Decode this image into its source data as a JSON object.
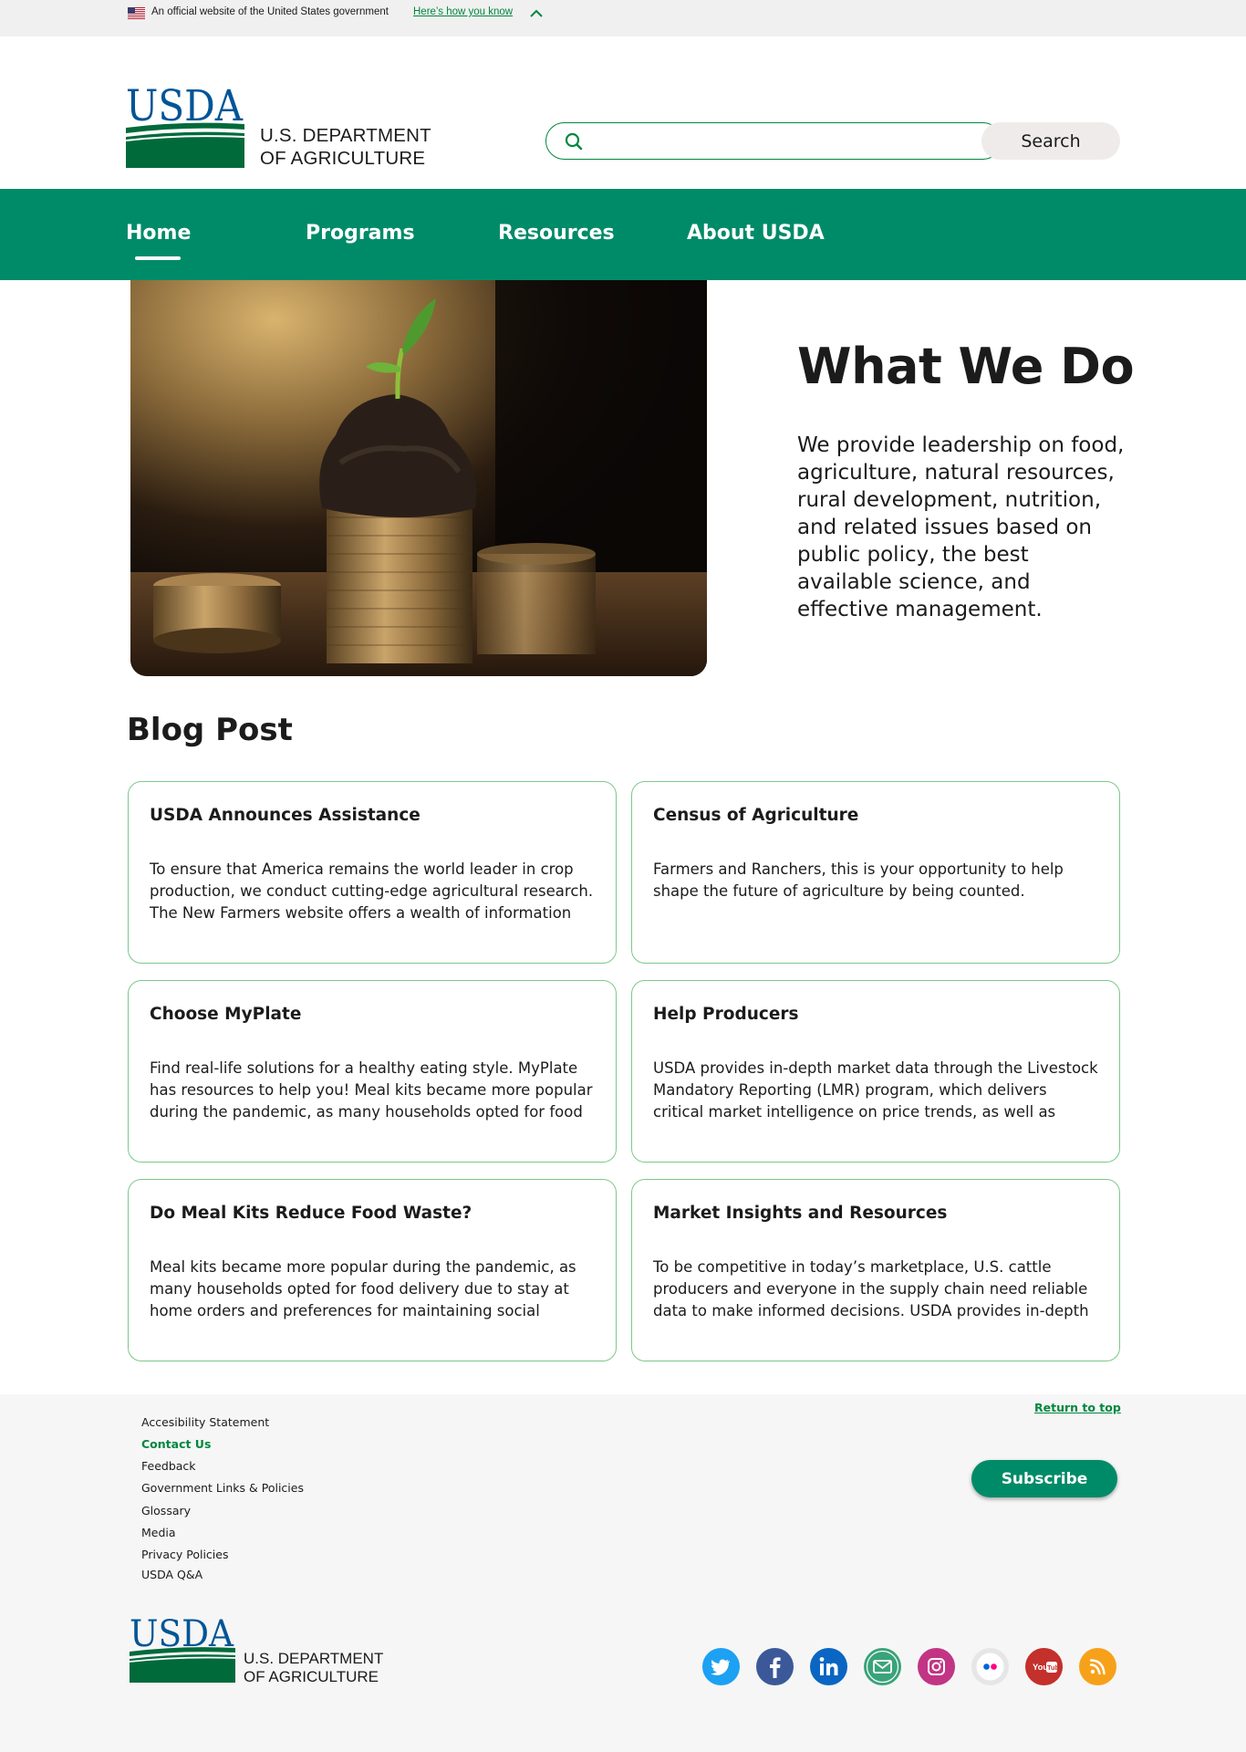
{
  "gov_banner": {
    "text": "An official website of the United States government",
    "link": "Here’s how you know"
  },
  "header": {
    "logo_text": "USDA",
    "agency_line1": "U.S. DEPARTMENT",
    "agency_line2": "OF AGRICULTURE",
    "search_placeholder": "",
    "search_button": "Search"
  },
  "nav": {
    "items": [
      {
        "label": "Home",
        "active": true
      },
      {
        "label": "Programs"
      },
      {
        "label": "Resources"
      },
      {
        "label": "About USDA"
      }
    ]
  },
  "hero": {
    "title": "What We Do",
    "text": "We provide leadership on food, agriculture, natural resources, rural development, nutrition, and related issues based on public policy, the best available science, and effective management."
  },
  "blog": {
    "heading": "Blog Post",
    "cards": [
      {
        "title": "USDA Announces Assistance",
        "body": "To ensure that America remains the world leader in crop production, we conduct cutting-edge agricultural research. The New Farmers website offers a wealth of information"
      },
      {
        "title": "Census of Agriculture",
        "body": "Farmers and Ranchers, this is your opportunity to help shape the future of agriculture by being counted."
      },
      {
        "title": "Choose MyPlate",
        "body": "Find real-life solutions for a healthy eating style. MyPlate has resources to help you! Meal kits became more popular during the pandemic, as many households opted for food"
      },
      {
        "title": "Help Producers",
        "body": "USDA provides in-depth market data through the Livestock Mandatory Reporting (LMR) program, which delivers critical market intelligence on price trends, as well as supply and"
      },
      {
        "title": "Do Meal Kits Reduce Food Waste?",
        "body": "Meal kits became more popular during the pandemic, as many households opted for food delivery due to stay at home orders and preferences for maintaining social"
      },
      {
        "title": "Market Insights and Resources",
        "body": "To be competitive in today’s marketplace, U.S. cattle producers and everyone in the supply chain need reliable data to make informed decisions. USDA provides in-depth"
      }
    ]
  },
  "footer": {
    "links": [
      {
        "label": "Accesibility Statement"
      },
      {
        "label": "Contact Us",
        "active": true
      },
      {
        "label": "Feedback"
      },
      {
        "label": "Government Links & Policies"
      },
      {
        "label": "Glossary"
      },
      {
        "label": "Media"
      },
      {
        "label": "Privacy Policies"
      },
      {
        "label": "USDA Q&A"
      }
    ],
    "return_top": "Return to top",
    "subscribe": "Subscribe",
    "logo_text": "USDA",
    "agency_line1": "U.S. DEPARTMENT",
    "agency_line2": "OF AGRICULTURE",
    "social": [
      {
        "icon": "twitter-icon",
        "color": "#1da1f2"
      },
      {
        "icon": "facebook-icon",
        "color": "#3b5998"
      },
      {
        "icon": "linkedin-icon",
        "color": "#0a66c2"
      },
      {
        "icon": "email-icon",
        "color": "#3aa37a"
      },
      {
        "icon": "instagram-icon",
        "color": "#c13584"
      },
      {
        "icon": "flickr-icon",
        "color": "#e0e0e0"
      },
      {
        "icon": "youtube-icon",
        "color": "#c4302b"
      },
      {
        "icon": "rss-icon",
        "color": "#f7a11a"
      }
    ]
  },
  "colors": {
    "primary_green": "#008b68",
    "link_green": "#00873e",
    "usda_blue": "#005596",
    "usda_green": "#006a3b"
  }
}
